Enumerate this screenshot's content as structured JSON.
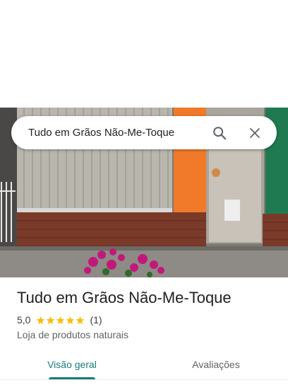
{
  "search": {
    "query": "Tudo em Grãos Não-Me-Toque",
    "search_icon": "search-icon",
    "close_icon": "close-icon"
  },
  "place": {
    "name": "Tudo em Grãos Não-Me-Toque",
    "rating": "5,0",
    "stars": 5,
    "review_count": "(1)",
    "category": "Loja de produtos naturais"
  },
  "tabs": [
    {
      "label": "Visão geral",
      "active": true
    },
    {
      "label": "Avaliações",
      "active": false
    }
  ],
  "colors": {
    "accent": "#1a7a7a",
    "star": "#fbbc04"
  }
}
